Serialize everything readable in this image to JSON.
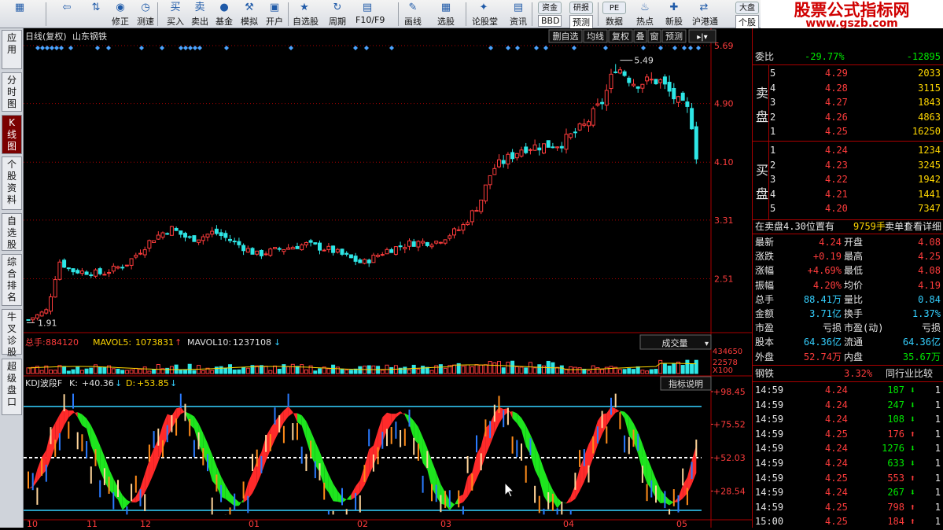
{
  "toolbar": {
    "items": [
      {
        "label": "",
        "icon": "grid-icon"
      },
      {
        "label": "",
        "icon": "back-arrow-icon"
      },
      {
        "label": "",
        "icon": "up-down-arrows-icon"
      },
      {
        "label": "修正",
        "icon": "revise-icon"
      },
      {
        "label": "测速",
        "icon": "clock-icon"
      },
      {
        "label": "买入",
        "icon": "buy-icon",
        "glyph": "买"
      },
      {
        "label": "卖出",
        "icon": "sell-icon",
        "glyph": "卖"
      },
      {
        "label": "基金",
        "icon": "fund-icon"
      },
      {
        "label": "模拟",
        "icon": "hammer-icon"
      },
      {
        "label": "开户",
        "icon": "account-icon"
      },
      {
        "label": "自选股",
        "icon": "star-icon"
      },
      {
        "label": "周期",
        "icon": "cycle-icon"
      },
      {
        "label": "F10/F9",
        "icon": "f10-icon"
      },
      {
        "label": "画线",
        "icon": "draw-icon"
      },
      {
        "label": "选股",
        "icon": "select-icon"
      },
      {
        "label": "论股堂",
        "icon": "forum-icon"
      },
      {
        "label": "资讯",
        "icon": "news-icon"
      },
      {
        "label": "BBD",
        "icon": "fund-tag-icon",
        "top": "资金"
      },
      {
        "label": "预测",
        "icon": "research-icon",
        "top": "研报"
      },
      {
        "label": "数据",
        "icon": "pe-icon",
        "top": "PE"
      },
      {
        "label": "热点",
        "icon": "hot-icon"
      },
      {
        "label": "新股",
        "icon": "new-icon"
      },
      {
        "label": "沪港通",
        "icon": "hk-icon"
      },
      {
        "label": "个股",
        "icon": "market-icon",
        "top": "大盘"
      }
    ]
  },
  "brand": {
    "line1": "股票公式指标网",
    "line2": "www.gszb.com"
  },
  "side_tabs": [
    "应用",
    "分时图",
    "K线图",
    "个股资料",
    "自选股",
    "综合排名",
    "牛叉诊股",
    "超级盘口"
  ],
  "chart_header": {
    "title": "日线(复权)",
    "stock": "山东钢铁",
    "buttons": [
      "删自选",
      "均线",
      "复权",
      "叠",
      "窗",
      "预测"
    ]
  },
  "price_panel": {
    "axis_labels": [
      "5.69",
      "4.90",
      "4.10",
      "3.31",
      "2.51"
    ],
    "high_label": "5.49",
    "low_label": "1.91"
  },
  "volume_panel": {
    "total_label": "总手:",
    "total_value": "884120",
    "mavol5_label": "MAVOL5:",
    "mavol5_value": "1073831",
    "mavol10_label": "MAVOL10:",
    "mavol10_value": "1237108",
    "dropdown": "成交量",
    "axis_labels": [
      "434650",
      "22578",
      "X100"
    ]
  },
  "kdj_panel": {
    "name": "KDJ波段F",
    "k_label": "K:",
    "k_value": "+40.36",
    "d_label": "D:",
    "d_value": "+53.85",
    "help_button": "指标说明",
    "axis_labels": [
      "+98.45",
      "+75.52",
      "+52.03",
      "+28.54"
    ]
  },
  "x_axis": {
    "labels": [
      "10",
      "11",
      "12",
      "01",
      "02",
      "03",
      "04",
      "05"
    ]
  },
  "quote": {
    "weibi_label": "委比",
    "weibi_pct": "-29.77%",
    "weibi_diff": "-12895",
    "sell_label": "卖盘",
    "buy_label": "买盘",
    "sell_levels": [
      {
        "n": "5",
        "price": "4.29",
        "vol": "2033"
      },
      {
        "n": "4",
        "price": "4.28",
        "vol": "3115"
      },
      {
        "n": "3",
        "price": "4.27",
        "vol": "1843"
      },
      {
        "n": "2",
        "price": "4.26",
        "vol": "4863"
      },
      {
        "n": "1",
        "price": "4.25",
        "vol": "16250"
      }
    ],
    "buy_levels": [
      {
        "n": "1",
        "price": "4.24",
        "vol": "1234"
      },
      {
        "n": "2",
        "price": "4.23",
        "vol": "3245"
      },
      {
        "n": "3",
        "price": "4.22",
        "vol": "1942"
      },
      {
        "n": "4",
        "price": "4.21",
        "vol": "1441"
      },
      {
        "n": "5",
        "price": "4.20",
        "vol": "7347"
      }
    ],
    "notice": {
      "text": "在卖盘4.30位置有",
      "qty": "9759手",
      "tail": "卖单!",
      "link": "查看详细"
    },
    "stats": [
      {
        "l1": "最新",
        "v1": "4.24",
        "l2": "开盘",
        "v2": "4.08"
      },
      {
        "l1": "涨跌",
        "v1": "+0.19",
        "l2": "最高",
        "v2": "4.25"
      },
      {
        "l1": "涨幅",
        "v1": "+4.69%",
        "l2": "最低",
        "v2": "4.08"
      },
      {
        "l1": "振幅",
        "v1": "4.20%",
        "l2": "均价",
        "v2": "4.19"
      },
      {
        "l1": "总手",
        "v1": "88.41万",
        "l2": "量比",
        "v2": "0.84"
      },
      {
        "l1": "金额",
        "v1": "3.71亿",
        "l2": "换手",
        "v2": "1.37%"
      },
      {
        "l1": "市盈",
        "v1": "亏损",
        "l2": "市盈(动)",
        "v2": "亏损"
      },
      {
        "l1": "股本",
        "v1": "64.36亿",
        "l2": "流通",
        "v2": "64.36亿"
      },
      {
        "l1": "外盘",
        "v1": "52.74万",
        "l2": "内盘",
        "v2": "35.67万"
      }
    ],
    "industry": {
      "name": "钢铁",
      "pct": "3.32%",
      "button": "同行业比较"
    },
    "ticks": [
      {
        "t": "14:59",
        "p": "4.24",
        "v": "187",
        "dir": "down",
        "n": "1"
      },
      {
        "t": "14:59",
        "p": "4.24",
        "v": "247",
        "dir": "down",
        "n": "1"
      },
      {
        "t": "14:59",
        "p": "4.24",
        "v": "108",
        "dir": "down",
        "n": "1"
      },
      {
        "t": "14:59",
        "p": "4.25",
        "v": "176",
        "dir": "up",
        "n": "1"
      },
      {
        "t": "14:59",
        "p": "4.24",
        "v": "1276",
        "dir": "down",
        "n": "1"
      },
      {
        "t": "14:59",
        "p": "4.24",
        "v": "633",
        "dir": "down",
        "n": "1"
      },
      {
        "t": "14:59",
        "p": "4.25",
        "v": "553",
        "dir": "up",
        "n": "1"
      },
      {
        "t": "14:59",
        "p": "4.24",
        "v": "267",
        "dir": "down",
        "n": "1"
      },
      {
        "t": "14:59",
        "p": "4.25",
        "v": "798",
        "dir": "up",
        "n": "1"
      },
      {
        "t": "15:00",
        "p": "4.25",
        "v": "184",
        "dir": "up",
        "n": "1"
      }
    ]
  },
  "colors": {
    "up": "#ff3c3c",
    "down": "#00e600",
    "cyan": "#34d0ff",
    "frame": "#aa0000",
    "candle_up": "#ff3c3c",
    "candle_down": "#2ee6e6"
  }
}
